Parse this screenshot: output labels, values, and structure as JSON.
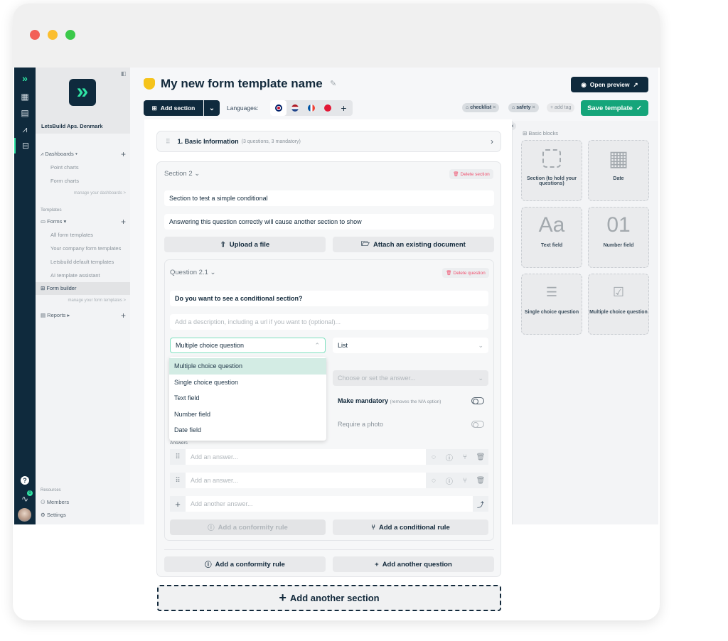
{
  "window": {
    "controls": [
      "close",
      "minimize",
      "maximize"
    ],
    "colors": {
      "close": "#f25f58",
      "minimize": "#fbbe2e",
      "maximize": "#3bc94a"
    }
  },
  "sidebar": {
    "company": "LetsBuild Aps. Denmark",
    "dashboards": {
      "label": "Dashboards",
      "items": [
        "Point charts",
        "Form charts"
      ],
      "manage": "manage your dashboards >"
    },
    "templates_heading": "Templates",
    "forms": {
      "label": "Forms",
      "items": [
        "All form templates",
        "Your company form templates",
        "Letsbuild default templates",
        "AI template assistant"
      ]
    },
    "form_builder": "Form builder",
    "manage_forms": "manage your form templates >",
    "reports": "Reports",
    "resources_heading": "Resources",
    "members": "Members",
    "settings": "Settings",
    "notification_count": "0"
  },
  "header": {
    "title": "My new form template name",
    "open_preview": "Open preview",
    "add_section": "Add section",
    "languages_label": "Languages:",
    "languages": [
      "English",
      "Dutch",
      "French",
      "Danish"
    ],
    "tags": [
      "checklist",
      "safety"
    ],
    "add_tag": "+ add tag",
    "save": "Save template"
  },
  "sections": {
    "first": {
      "title": "1. Basic Information",
      "meta": "(3 questions, 3 mandatory)"
    },
    "second": {
      "title": "Section 2",
      "delete": "Delete section",
      "name": "Section to test a simple conditional",
      "description": "Answering this question correctly will cause another section to show",
      "upload": "Upload a file",
      "attach": "Attach an existing document",
      "question": {
        "title": "Question 2.1",
        "delete": "Delete question",
        "text": "Do you want to see a conditional section?",
        "description_placeholder": "Add a description, including a url if you want to (optional)...",
        "type": "Multiple choice question",
        "type_options": [
          "Multiple choice question",
          "Single choice question",
          "Text field",
          "Number field",
          "Date field"
        ],
        "display": "List",
        "answer_placeholder": "Choose or set the answer...",
        "mandatory": "Make mandatory",
        "mandatory_note": "(removes the N/A option)",
        "mandatory_on": false,
        "photo": "Require a photo",
        "photo_on": false,
        "answers_label": "Answers",
        "answer_inputs": [
          "Add an answer...",
          "Add an answer..."
        ],
        "add_answer": "Add another answer...",
        "conformity": "Add a conformity rule",
        "conditional": "Add a conditional rule"
      },
      "conformity": "Add a conformity rule",
      "add_question": "Add another question"
    },
    "add_section": "Add another section"
  },
  "blocks": {
    "heading": "Basic blocks",
    "items": [
      {
        "label": "Section (to hold your questions)",
        "icon": "dashed-square-icon"
      },
      {
        "label": "Date",
        "icon": "calendar-icon"
      },
      {
        "label": "Text field",
        "icon": "Aa"
      },
      {
        "label": "Number field",
        "icon": "01"
      },
      {
        "label": "Single choice question",
        "icon": "radio-list-icon"
      },
      {
        "label": "Multiple choice question",
        "icon": "check-list-icon"
      }
    ]
  }
}
